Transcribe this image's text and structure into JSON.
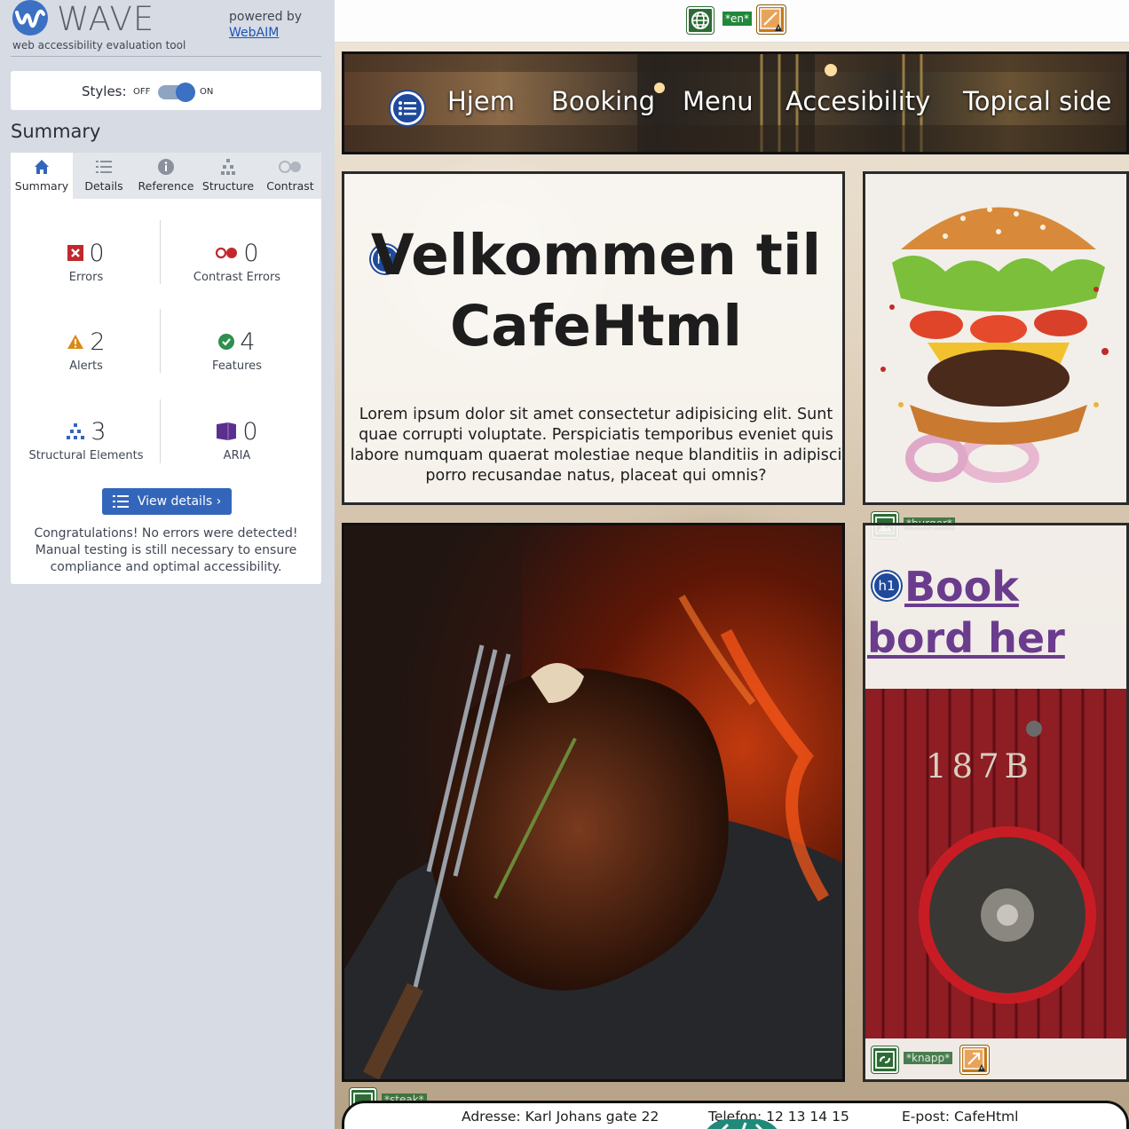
{
  "wave": {
    "brand": "WAVE",
    "subtitle": "web accessibility evaluation tool",
    "powered_by": "powered by",
    "powered_link": "WebAIM",
    "styles_label": "Styles:",
    "toggle_off": "OFF",
    "toggle_on": "ON",
    "summary_title": "Summary",
    "tabs": [
      {
        "label": "Summary",
        "icon": "home-icon",
        "active": true
      },
      {
        "label": "Details",
        "icon": "list-icon",
        "active": false
      },
      {
        "label": "Reference",
        "icon": "info-icon",
        "active": false
      },
      {
        "label": "Structure",
        "icon": "hierarchy-icon",
        "active": false
      },
      {
        "label": "Contrast",
        "icon": "contrast-icon",
        "active": false
      }
    ],
    "stats": {
      "errors": {
        "count": "0",
        "label": "Errors"
      },
      "contrast_errors": {
        "count": "0",
        "label": "Contrast Errors"
      },
      "alerts": {
        "count": "2",
        "label": "Alerts"
      },
      "features": {
        "count": "4",
        "label": "Features"
      },
      "structural": {
        "count": "3",
        "label": "Structural Elements"
      },
      "aria": {
        "count": "0",
        "label": "ARIA"
      }
    },
    "view_details": "View details ›",
    "congrats": "Congratulations! No errors were detected! Manual testing is still necessary to ensure compliance and optimal accessibility."
  },
  "page": {
    "lang_marker": "*en*",
    "nav": [
      "Hjem",
      "Booking",
      "Menu",
      "Accesibility",
      "Topical side"
    ],
    "h1_badge": "h1",
    "welcome_title": "Velkommen til CafeHtml",
    "welcome_text": "Lorem ipsum dolor sit amet consectetur adipisicing elit. Sunt quae corrupti voluptate. Perspiciatis temporibus eveniet quis labore numquam quaerat molestiae neque blanditiis in adipisci porro recusandae natus, placeat qui omnis?",
    "burger_alt": "*burger*",
    "book_link": "Book bord her",
    "knapp_alt": "*knapp*",
    "steak_alt": "*steak*",
    "door_number": "187B",
    "footer": {
      "address": "Adresse: Karl Johans gate 22",
      "phone": "Telefon: 12 13 14 15",
      "email": "E-post: CafeHtml"
    }
  },
  "colors": {
    "wave_blue": "#3366bb",
    "sidebar_bg": "#d6dbe4",
    "error_red": "#c0282e",
    "alert_orange": "#d78b16",
    "feature_green": "#2f8f4e",
    "aria_purple": "#5b2f8e",
    "link_purple": "#6b3c8e"
  }
}
